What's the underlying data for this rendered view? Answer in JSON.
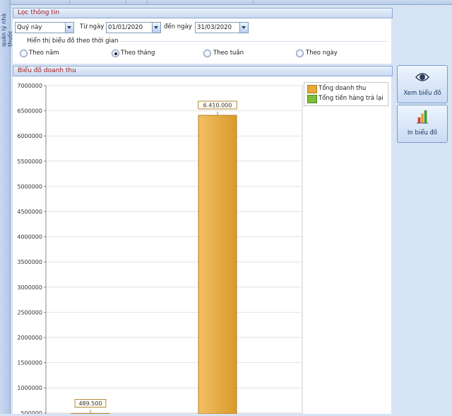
{
  "sidebar_tab": {
    "label": "quản lý nhà thuốc"
  },
  "filter": {
    "title": "Lọc thông tin",
    "period_select": "Quý này",
    "from_label": "Từ ngày",
    "from_date": "01/01/2020",
    "to_label": "đến ngày",
    "to_date": "31/03/2020",
    "group_label": "Hiển thị biểu đồ theo thời gian",
    "options": [
      {
        "label": "Theo năm",
        "selected": false
      },
      {
        "label": "Theo tháng",
        "selected": true
      },
      {
        "label": "Theo tuần",
        "selected": false
      },
      {
        "label": "Theo ngày",
        "selected": false
      }
    ]
  },
  "chart_panel": {
    "title": "Biểu đồ doanh thu"
  },
  "buttons": {
    "view_label": "Xem biểu đồ",
    "print_label": "In biểu đồ"
  },
  "chart_data": {
    "type": "bar",
    "title": "",
    "xlabel": "",
    "ylabel": "",
    "ylim": [
      500000,
      7000000
    ],
    "yticks": [
      "7000000",
      "6500000",
      "6000000",
      "5500000",
      "5000000",
      "4500000",
      "4000000",
      "3500000",
      "3000000",
      "2500000",
      "2000000",
      "1500000",
      "1000000",
      "500000"
    ],
    "grid": true,
    "legend_position": "top-right",
    "series": [
      {
        "name": "Tổng doanh thu",
        "color": "#e8a838",
        "values": [
          489500,
          6410000
        ]
      },
      {
        "name": "Tổng tiền hàng trả lại",
        "color": "#7cbd3a",
        "values": [
          0,
          0
        ]
      }
    ],
    "data_labels": [
      "489.500",
      "6.410.000"
    ]
  }
}
